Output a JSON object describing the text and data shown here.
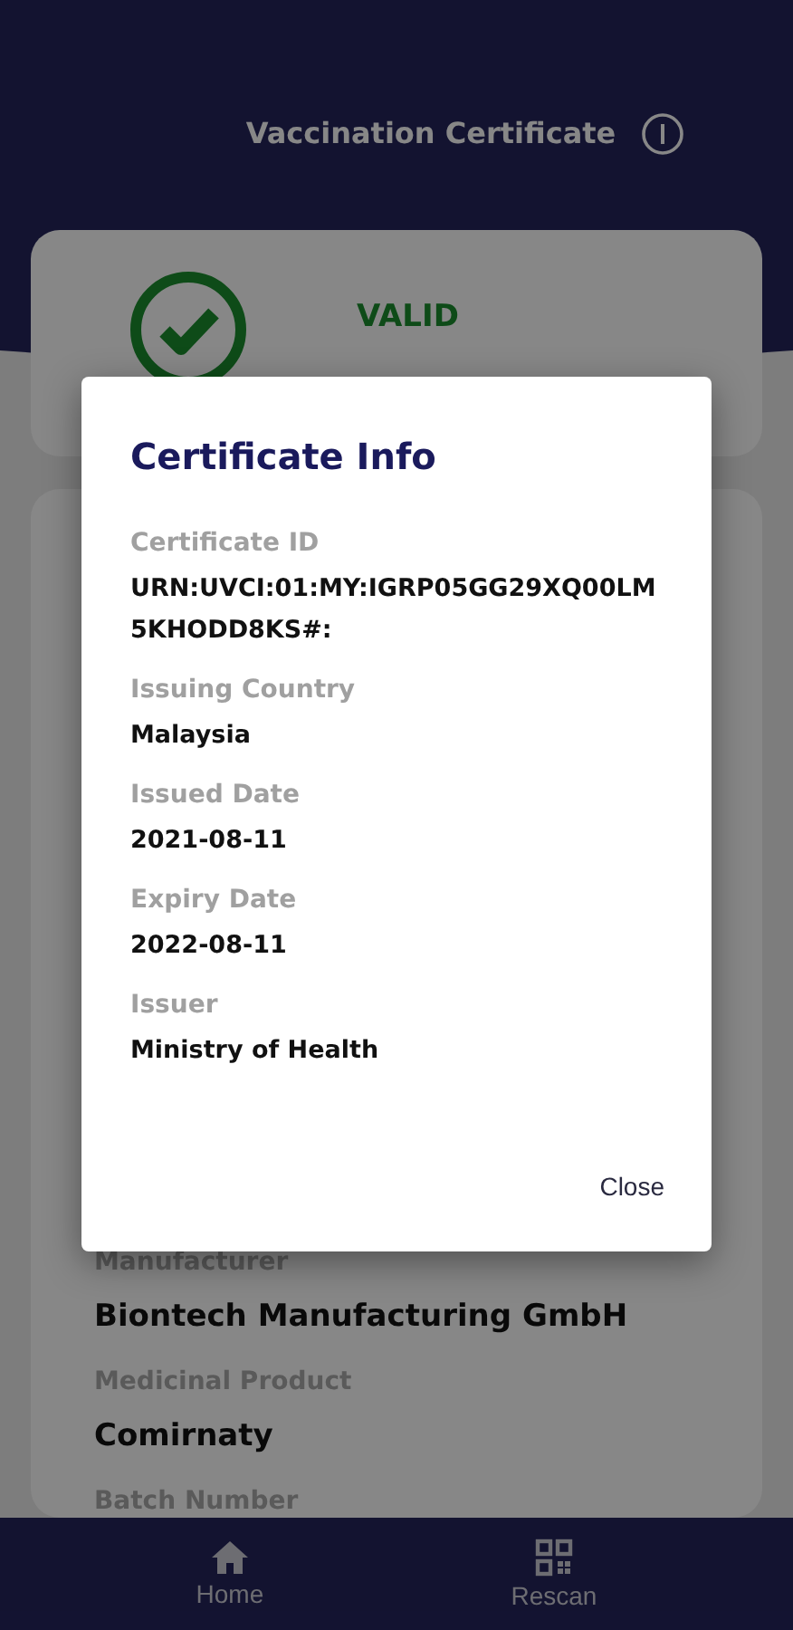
{
  "header": {
    "title": "Vaccination Certificate"
  },
  "status": {
    "label": "VALID",
    "valid": true
  },
  "details": [
    {
      "label": "Manufacturer",
      "value": "Biontech Manufacturing GmbH"
    },
    {
      "label": "Medicinal Product",
      "value": "Comirnaty"
    },
    {
      "label": "Batch Number"
    }
  ],
  "dialog": {
    "title": "Certificate Info",
    "fields": [
      {
        "label": "Certificate ID",
        "value": "URN:UVCI:01:MY:IGRP05GG29XQ00LM5KHODD8KS#:"
      },
      {
        "label": "Issuing Country",
        "value": "Malaysia"
      },
      {
        "label": "Issued Date",
        "value": "2021-08-11"
      },
      {
        "label": "Expiry Date",
        "value": "2022-08-11"
      },
      {
        "label": "Issuer",
        "value": "Ministry of Health"
      }
    ],
    "close": "Close"
  },
  "nav": [
    {
      "label": "Home",
      "kind": "home"
    },
    {
      "label": "Rescan",
      "kind": "qr"
    }
  ]
}
